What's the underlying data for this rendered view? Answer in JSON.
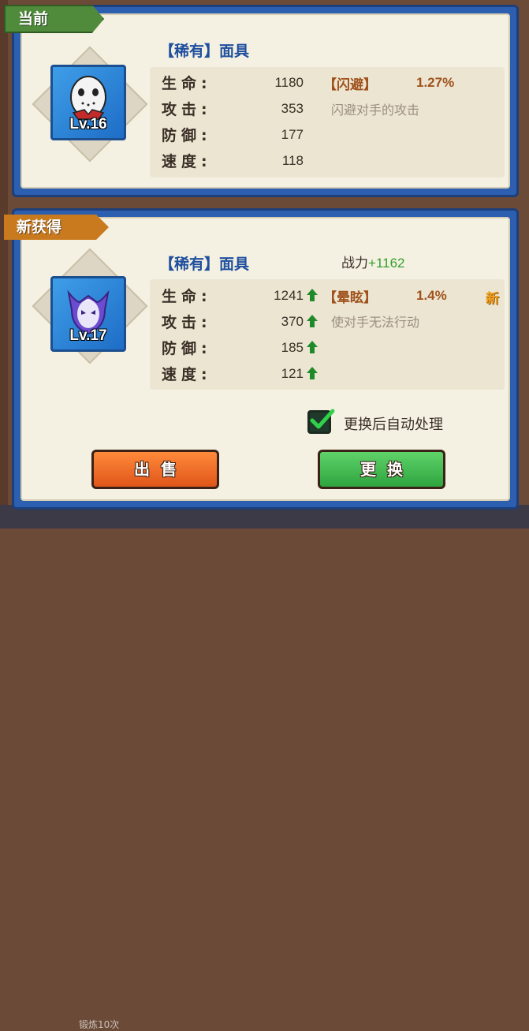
{
  "current": {
    "tag": "当前",
    "item_title": "【稀有】面具",
    "level": "Lv.16",
    "stats": [
      {
        "label": "生命:",
        "value": "1180"
      },
      {
        "label": "攻击:",
        "value": "353"
      },
      {
        "label": "防御:",
        "value": "177"
      },
      {
        "label": "速度:",
        "value": "118"
      }
    ],
    "skill": {
      "name": "【闪避】",
      "percent": "1.27%",
      "desc": "闪避对手的攻击"
    }
  },
  "new_item": {
    "tag": "新获得",
    "item_title": "【稀有】面具",
    "level": "Lv.17",
    "power_label": "战力",
    "power_delta": "+1162",
    "stats": [
      {
        "label": "生命:",
        "value": "1241"
      },
      {
        "label": "攻击:",
        "value": "370"
      },
      {
        "label": "防御:",
        "value": "185"
      },
      {
        "label": "速度:",
        "value": "121"
      }
    ],
    "skill": {
      "name": "【晕眩】",
      "percent": "1.4%",
      "desc": "使对手无法行动",
      "new_badge": "新"
    }
  },
  "auto_process": {
    "label": "更换后自动处理",
    "checked": true
  },
  "buttons": {
    "sell": "出售",
    "replace": "更换"
  },
  "background": {
    "bottom_text": "锻炼10次"
  },
  "colors": {
    "panel_blue": "#2c5fb0",
    "accent_green": "#33a02c",
    "skill_brown": "#a0521c"
  }
}
